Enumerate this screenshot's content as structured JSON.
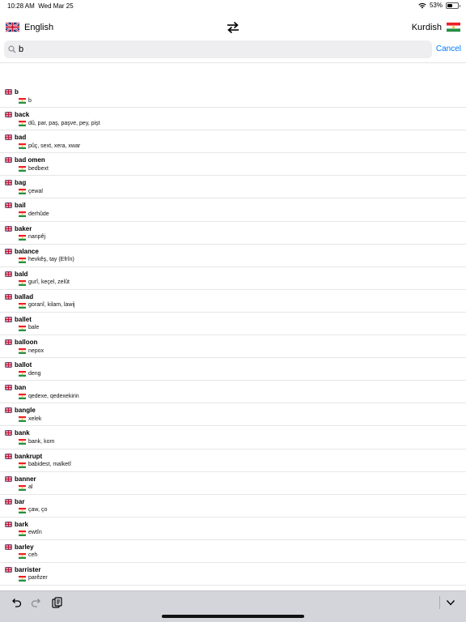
{
  "status": {
    "time": "10:28 AM",
    "date": "Wed Mar 25",
    "battery": "53%",
    "battery_level": 0.53
  },
  "header": {
    "source_language": "English",
    "target_language": "Kurdish"
  },
  "search": {
    "query": "b",
    "cancel_label": "Cancel"
  },
  "results": [
    {
      "word": "b",
      "translation": "b"
    },
    {
      "word": "back",
      "translation": "dû, par, paş, paşve, pey, pişt"
    },
    {
      "word": "bad",
      "translation": "pûç, sext, xera, xwar"
    },
    {
      "word": "bad omen",
      "translation": "bedbext"
    },
    {
      "word": "bag",
      "translation": "çewal"
    },
    {
      "word": "bail",
      "translation": "derhûde"
    },
    {
      "word": "baker",
      "translation": "nanpêj"
    },
    {
      "word": "balance",
      "translation": "hevkêş, tay (Efrîn)"
    },
    {
      "word": "bald",
      "translation": "gurî, keçel, zelût"
    },
    {
      "word": "ballad",
      "translation": "goranî, kilam, lawij"
    },
    {
      "word": "ballet",
      "translation": "bale"
    },
    {
      "word": "balloon",
      "translation": "nepox"
    },
    {
      "word": "ballot",
      "translation": "deng"
    },
    {
      "word": "ban",
      "translation": "qedexe, qedexekirin"
    },
    {
      "word": "bangle",
      "translation": "xelek"
    },
    {
      "word": "bank",
      "translation": "bank, kom"
    },
    {
      "word": "bankrupt",
      "translation": "babidest, malketî"
    },
    {
      "word": "banner",
      "translation": "al"
    },
    {
      "word": "bar",
      "translation": "çaw, ço"
    },
    {
      "word": "bark",
      "translation": "ewtîn"
    },
    {
      "word": "barley",
      "translation": "ceh"
    },
    {
      "word": "barrister",
      "translation": "parêzer"
    }
  ],
  "icons": {
    "swap": "swap-arrows-icon",
    "search": "magnifier-icon",
    "undo": "undo-icon",
    "redo": "redo-icon",
    "paste": "paste-icon",
    "dismiss": "chevron-down-icon"
  }
}
